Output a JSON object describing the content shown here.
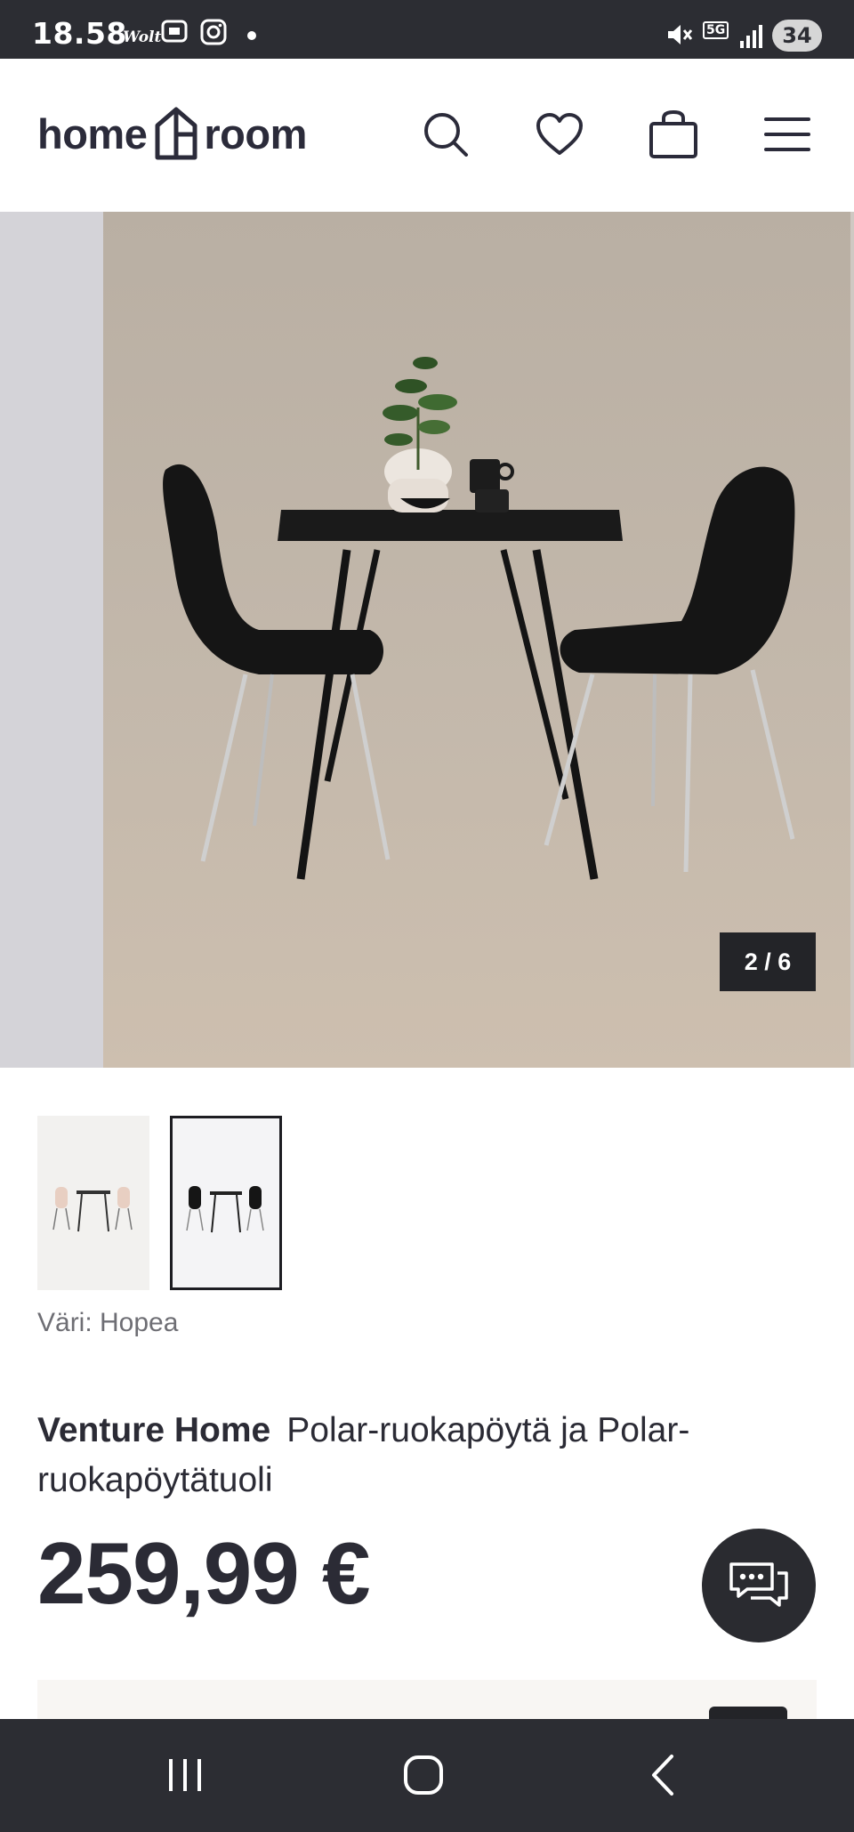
{
  "status_bar": {
    "time": "18.58",
    "app_wolt": "Wolt",
    "network": "5G",
    "battery": "34"
  },
  "header": {
    "logo_left": "home",
    "logo_right": "room",
    "icons": [
      "search-icon",
      "heart-icon",
      "bag-icon",
      "menu-icon"
    ]
  },
  "gallery": {
    "counter": "2 / 6"
  },
  "product": {
    "color_label": "Väri: Hopea",
    "brand": "Venture Home",
    "name": "Polar-ruokapöytä ja Polar-ruokapöytätuoli",
    "price": "259,99 €"
  },
  "colors": {
    "dark": "#2c2d33",
    "background_image": "#c8bcae",
    "accent_text": "#2b2b35"
  }
}
